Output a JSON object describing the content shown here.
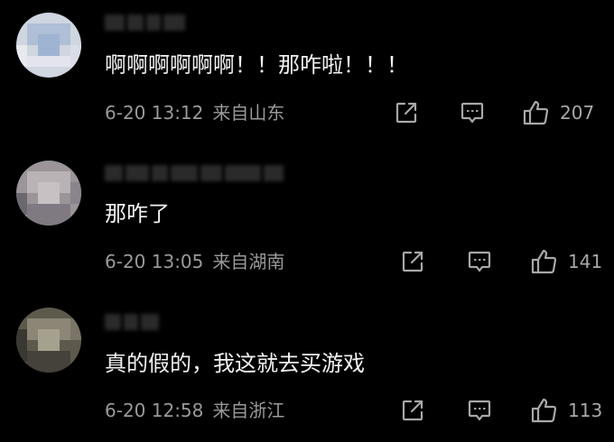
{
  "comments": [
    {
      "username": "",
      "content": "啊啊啊啊啊啊！！那咋啦！！！",
      "date": "6-20 13:12",
      "location": "来自山东",
      "likes": "207",
      "icons": [
        "share-icon",
        "comment-icon",
        "thumbs-up-icon"
      ]
    },
    {
      "username": "",
      "content": "那咋了",
      "date": "6-20 13:05",
      "location": "来自湖南",
      "likes": "141",
      "icons": [
        "share-icon",
        "comment-icon",
        "thumbs-up-icon"
      ]
    },
    {
      "username": "",
      "content": "真的假的，我这就去买游戏",
      "date": "6-20 12:58",
      "location": "来自浙江",
      "likes": "113",
      "icons": [
        "share-icon",
        "comment-icon",
        "thumbs-up-icon"
      ]
    }
  ],
  "colors": {
    "background": "#000000",
    "text": "#f2f2f2",
    "meta": "#9a9a9a"
  }
}
